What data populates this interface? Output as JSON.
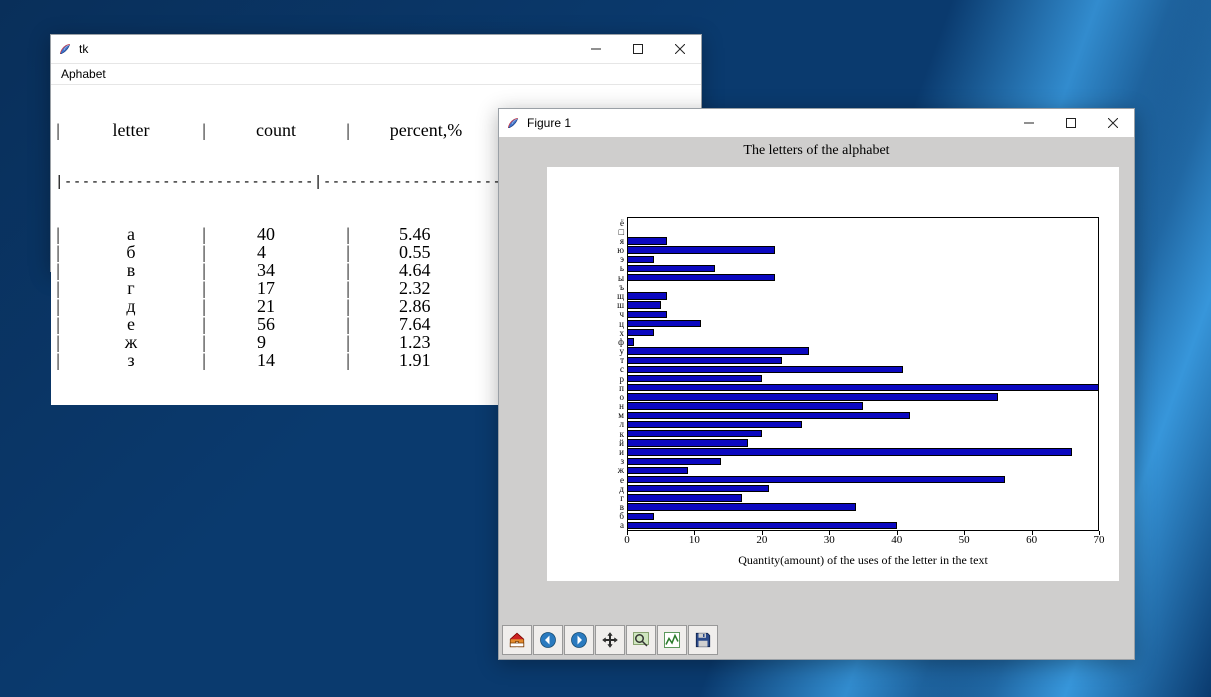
{
  "tk_window": {
    "title": "tk",
    "menu": "Aphabet",
    "columns": {
      "letter": "letter",
      "count": "count",
      "percent": "percent,%"
    },
    "rows": [
      {
        "letter": "а",
        "count": "40",
        "percent": "5.46"
      },
      {
        "letter": "б",
        "count": "4",
        "percent": "0.55"
      },
      {
        "letter": "в",
        "count": "34",
        "percent": "4.64"
      },
      {
        "letter": "г",
        "count": "17",
        "percent": "2.32"
      },
      {
        "letter": "д",
        "count": "21",
        "percent": "2.86"
      },
      {
        "letter": "е",
        "count": "56",
        "percent": "7.64"
      },
      {
        "letter": "ж",
        "count": "9",
        "percent": "1.23"
      },
      {
        "letter": "з",
        "count": "14",
        "percent": "1.91"
      }
    ]
  },
  "figure_window": {
    "title": "Figure 1"
  },
  "chart_data": {
    "type": "bar",
    "orientation": "horizontal",
    "title": "The letters of the alphabet",
    "xlabel": "Quantity(amount) of the uses of the letter in the text",
    "ylabel": "",
    "xlim": [
      0,
      70
    ],
    "xticks": [
      0,
      10,
      20,
      30,
      40,
      50,
      60,
      70
    ],
    "categories": [
      "а",
      "б",
      "в",
      "г",
      "д",
      "е",
      "ж",
      "з",
      "и",
      "й",
      "к",
      "л",
      "м",
      "н",
      "о",
      "п",
      "р",
      "с",
      "т",
      "у",
      "ф",
      "х",
      "ц",
      "ч",
      "ш",
      "щ",
      "ъ",
      "ы",
      "ь",
      "э",
      "ю",
      "я",
      "□",
      "ё"
    ],
    "values": [
      40,
      4,
      34,
      17,
      21,
      56,
      9,
      14,
      66,
      18,
      20,
      26,
      42,
      35,
      55,
      70,
      20,
      41,
      23,
      27,
      1,
      4,
      11,
      6,
      5,
      6,
      0,
      22,
      13,
      4,
      22,
      6,
      0,
      0
    ]
  },
  "toolbar": {
    "home": "Home",
    "back": "Back",
    "forward": "Forward",
    "pan": "Pan",
    "zoom": "Zoom",
    "subplots": "Configure subplots",
    "save": "Save"
  }
}
